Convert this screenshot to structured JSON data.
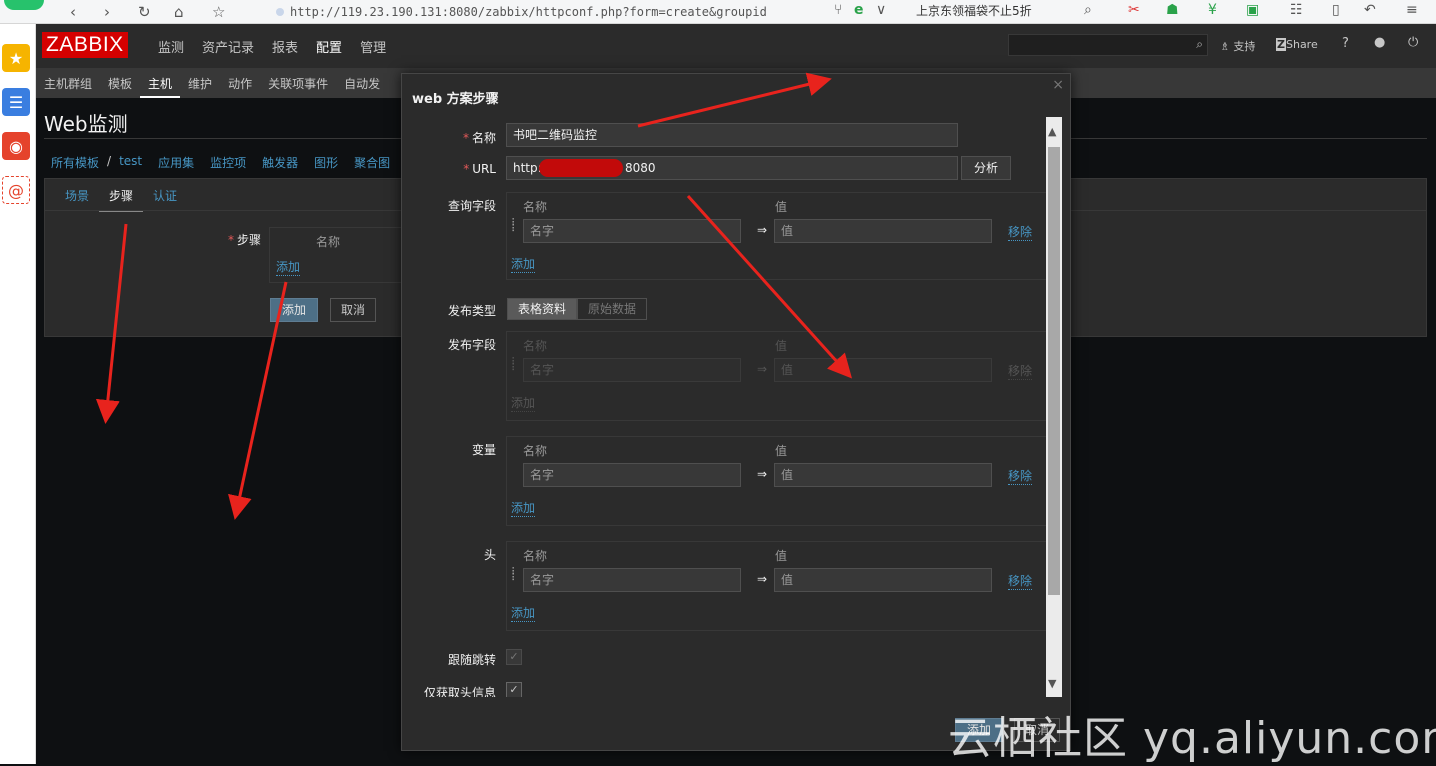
{
  "browser": {
    "url": "http://119.23.190.131:8080/zabbix/httpconf.php?form=create&groupid",
    "ticker": "上京东领福袋不止5折"
  },
  "topnav": {
    "brand": "ZABBIX",
    "menu": [
      "监测",
      "资产记录",
      "报表",
      "配置",
      "管理"
    ],
    "active_menu": "配置",
    "support": "支持",
    "share": "Share",
    "help": "?"
  },
  "subnav": {
    "items": [
      "主机群组",
      "模板",
      "主机",
      "维护",
      "动作",
      "关联项事件",
      "自动发"
    ],
    "active": "主机"
  },
  "page": {
    "title": "Web监测",
    "breadcrumb": [
      "所有模板",
      "/",
      "test",
      "应用集",
      "监控项",
      "触发器",
      "图形",
      "聚合图"
    ],
    "tabs": [
      "场景",
      "步骤",
      "认证"
    ],
    "active_tab": "步骤",
    "steps_label": "步骤",
    "steps_col": "名称",
    "steps_add": "添加",
    "btn_add": "添加",
    "btn_cancel": "取消"
  },
  "modal": {
    "title": "web 方案步骤",
    "close": "×",
    "name_label": "名称",
    "name_value": "书吧二维码监控",
    "url_label": "URL",
    "url_prefix": "http://",
    "url_suffix": "8080",
    "analyze": "分析",
    "query_label": "查询字段",
    "col_name": "名称",
    "col_value": "值",
    "ph_name": "名字",
    "ph_value": "值",
    "arrow": "⇒",
    "remove": "移除",
    "add": "添加",
    "post_type_label": "发布类型",
    "post_type_options": [
      "表格资料",
      "原始数据"
    ],
    "post_type_selected": "表格资料",
    "post_fields_label": "发布字段",
    "variables_label": "变量",
    "headers_label": "头",
    "follow_label": "跟随跳转",
    "headers_only_label": "仅获取头信息",
    "check": "✓",
    "btn_add": "添加",
    "btn_cancel": "取消"
  },
  "watermark": "云栖社区 yq.aliyun.com",
  "colors": {
    "zabbix_red": "#d40000",
    "link_blue": "#4796c4",
    "panel_bg": "#2b2b2b",
    "annotation_red": "#e8231d"
  }
}
